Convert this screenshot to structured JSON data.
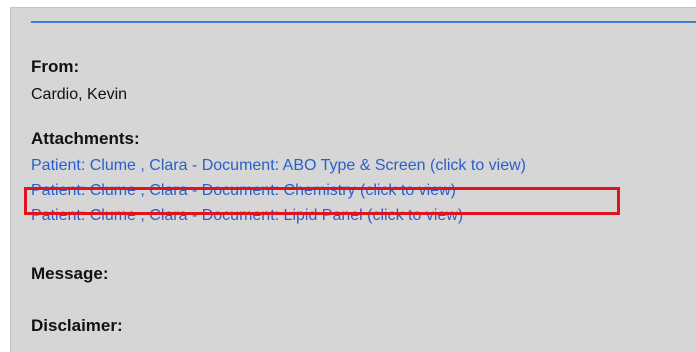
{
  "from": {
    "label": "From:",
    "value": "Cardio, Kevin"
  },
  "attachments": {
    "label": "Attachments:",
    "items": [
      {
        "text": "Patient: Clume   , Clara - Document: ABO Type & Screen (click to view)"
      },
      {
        "text": "Patient: Clume   , Clara - Document: Chemistry (click to view)"
      },
      {
        "text": "Patient: Clume   , Clara - Document: Lipid Panel (click to view)"
      }
    ]
  },
  "message": {
    "label": "Message:"
  },
  "disclaimer": {
    "label": "Disclaimer:"
  },
  "colors": {
    "link": "#2a5fc9",
    "highlight": "#e0141e",
    "panel_bg": "#d6d6d6",
    "rule": "#3d7fd6"
  }
}
